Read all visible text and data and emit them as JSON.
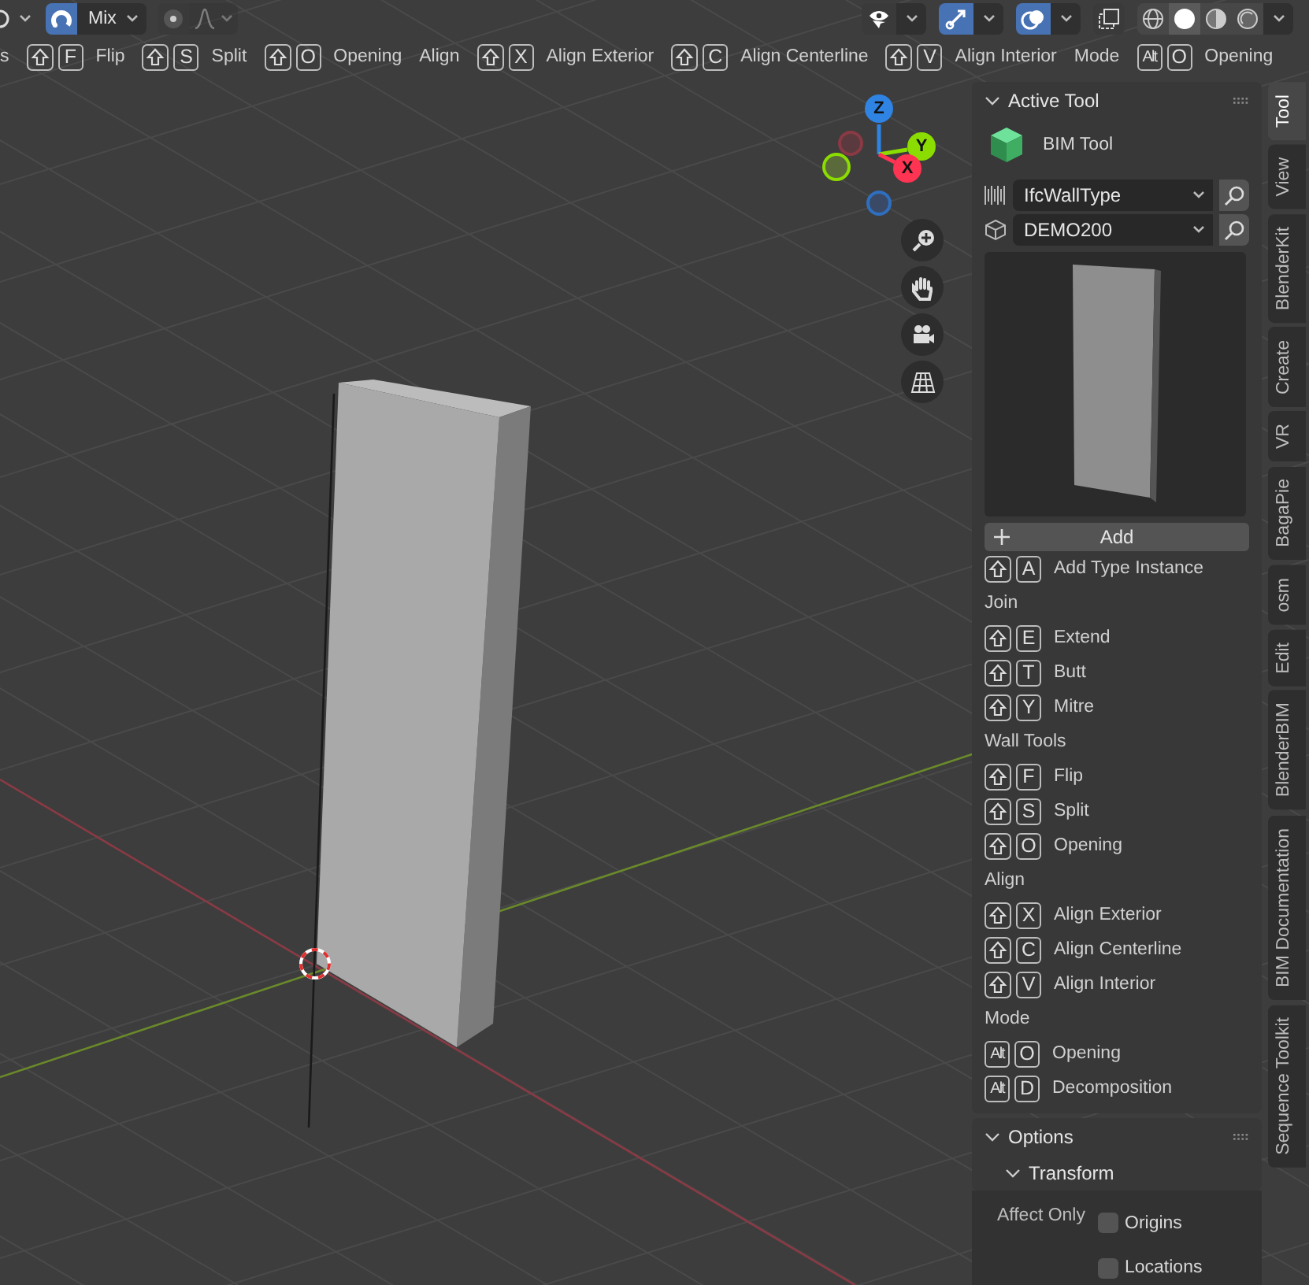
{
  "header": {
    "left_tools": [
      {
        "kind": "pivot",
        "on": false
      },
      {
        "kind": "snap",
        "on": true
      },
      {
        "kind": "dropdown",
        "label": "Mix"
      },
      {
        "kind": "proportional",
        "on": false
      },
      {
        "kind": "falloff",
        "disabled": true
      }
    ],
    "right_tools": [
      {
        "kind": "visibility",
        "on": false
      },
      {
        "kind": "gizmo",
        "on": true
      },
      {
        "kind": "overlay",
        "on": true
      },
      {
        "kind": "xray",
        "on": false
      }
    ],
    "shading": [
      {
        "kind": "wireframe",
        "selected": false
      },
      {
        "kind": "solid",
        "selected": true
      },
      {
        "kind": "material",
        "selected": false
      },
      {
        "kind": "rendered",
        "selected": false
      }
    ]
  },
  "hints": [
    {
      "kind": "heading",
      "label": "s"
    },
    {
      "kind": "shortcut",
      "keys": [
        {
          "kind": "shift"
        },
        {
          "kind": "text",
          "label": "F"
        }
      ],
      "label": "Flip"
    },
    {
      "kind": "shortcut",
      "keys": [
        {
          "kind": "shift"
        },
        {
          "kind": "text",
          "label": "S"
        }
      ],
      "label": "Split"
    },
    {
      "kind": "shortcut",
      "keys": [
        {
          "kind": "shift"
        },
        {
          "kind": "text",
          "label": "O"
        }
      ],
      "label": "Opening"
    },
    {
      "kind": "heading",
      "label": "Align"
    },
    {
      "kind": "shortcut",
      "keys": [
        {
          "kind": "shift"
        },
        {
          "kind": "text",
          "label": "X"
        }
      ],
      "label": "Align Exterior"
    },
    {
      "kind": "shortcut",
      "keys": [
        {
          "kind": "shift"
        },
        {
          "kind": "text",
          "label": "C"
        }
      ],
      "label": "Align Centerline"
    },
    {
      "kind": "shortcut",
      "keys": [
        {
          "kind": "shift"
        },
        {
          "kind": "text",
          "label": "V"
        }
      ],
      "label": "Align Interior"
    },
    {
      "kind": "heading",
      "label": "Mode"
    },
    {
      "kind": "shortcut",
      "keys": [
        {
          "kind": "text",
          "label": "Alt"
        },
        {
          "kind": "text",
          "label": "O"
        }
      ],
      "label": "Opening"
    }
  ],
  "gizmo_axes": [
    {
      "label": "Z",
      "color": "#2f83e3"
    },
    {
      "label": "Y",
      "color": "#8bdc00"
    },
    {
      "label": "X",
      "color": "#ff3352"
    }
  ],
  "active_tool": {
    "title": "Active Tool",
    "expanded": true,
    "tool_name": "BIM Tool",
    "type_class": "IfcWallType",
    "type_name": "DEMO200",
    "add_button": "Add",
    "groups": [
      {
        "items": [
          {
            "keys": [
              {
                "kind": "shift"
              },
              {
                "kind": "text",
                "label": "A"
              }
            ],
            "label": "Add Type Instance"
          }
        ]
      },
      {
        "heading": "Join",
        "items": [
          {
            "keys": [
              {
                "kind": "shift"
              },
              {
                "kind": "text",
                "label": "E"
              }
            ],
            "label": "Extend"
          },
          {
            "keys": [
              {
                "kind": "shift"
              },
              {
                "kind": "text",
                "label": "T"
              }
            ],
            "label": "Butt"
          },
          {
            "keys": [
              {
                "kind": "shift"
              },
              {
                "kind": "text",
                "label": "Y"
              }
            ],
            "label": "Mitre"
          }
        ]
      },
      {
        "heading": "Wall Tools",
        "items": [
          {
            "keys": [
              {
                "kind": "shift"
              },
              {
                "kind": "text",
                "label": "F"
              }
            ],
            "label": "Flip"
          },
          {
            "keys": [
              {
                "kind": "shift"
              },
              {
                "kind": "text",
                "label": "S"
              }
            ],
            "label": "Split"
          },
          {
            "keys": [
              {
                "kind": "shift"
              },
              {
                "kind": "text",
                "label": "O"
              }
            ],
            "label": "Opening"
          }
        ]
      },
      {
        "heading": "Align",
        "items": [
          {
            "keys": [
              {
                "kind": "shift"
              },
              {
                "kind": "text",
                "label": "X"
              }
            ],
            "label": "Align Exterior"
          },
          {
            "keys": [
              {
                "kind": "shift"
              },
              {
                "kind": "text",
                "label": "C"
              }
            ],
            "label": "Align Centerline"
          },
          {
            "keys": [
              {
                "kind": "shift"
              },
              {
                "kind": "text",
                "label": "V"
              }
            ],
            "label": "Align Interior"
          }
        ]
      },
      {
        "heading": "Mode",
        "items": [
          {
            "keys": [
              {
                "kind": "text",
                "label": "Alt"
              },
              {
                "kind": "text",
                "label": "O"
              }
            ],
            "label": "Opening"
          },
          {
            "keys": [
              {
                "kind": "text",
                "label": "Alt"
              },
              {
                "kind": "text",
                "label": "D"
              }
            ],
            "label": "Decomposition"
          }
        ]
      }
    ]
  },
  "options": {
    "title": "Options",
    "expanded": true,
    "subpanel": {
      "title": "Transform",
      "expanded": true
    },
    "affect_only": {
      "label": "Affect Only",
      "choices": [
        {
          "label": "Origins",
          "checked": false
        },
        {
          "label": "Locations",
          "checked": false
        }
      ]
    }
  },
  "tabs": [
    {
      "label": "Tool",
      "selected": true
    },
    {
      "label": "View",
      "selected": false
    },
    {
      "label": "BlenderKit",
      "selected": false
    },
    {
      "label": "Create",
      "selected": false
    },
    {
      "label": "VR",
      "selected": false
    },
    {
      "label": "BagaPie",
      "selected": false
    },
    {
      "label": "osm",
      "selected": false
    },
    {
      "label": "Edit",
      "selected": false
    },
    {
      "label": "BlenderBIM",
      "selected": false
    },
    {
      "label": "BIM Documentation",
      "selected": false
    },
    {
      "label": "Sequence Toolkit",
      "selected": false
    }
  ]
}
